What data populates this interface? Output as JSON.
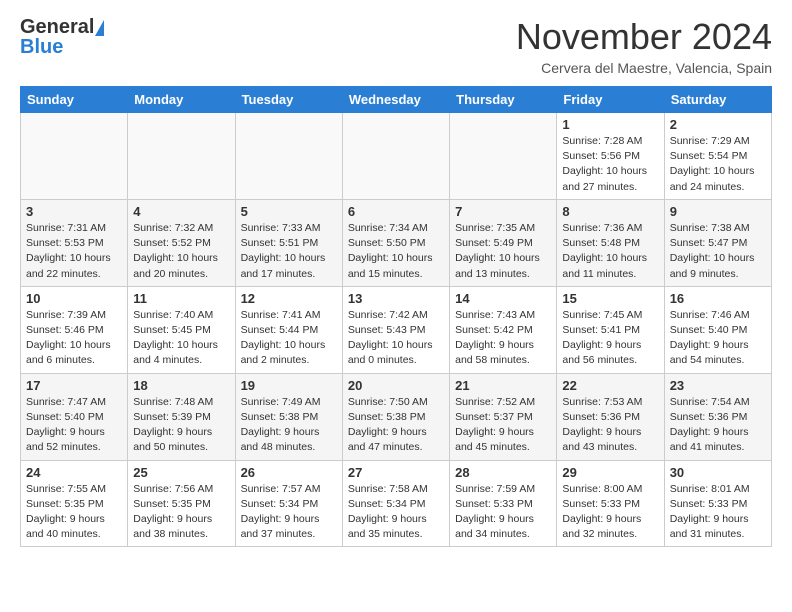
{
  "header": {
    "logo_general": "General",
    "logo_blue": "Blue",
    "month_title": "November 2024",
    "location": "Cervera del Maestre, Valencia, Spain"
  },
  "weekdays": [
    "Sunday",
    "Monday",
    "Tuesday",
    "Wednesday",
    "Thursday",
    "Friday",
    "Saturday"
  ],
  "weeks": [
    [
      {
        "day": "",
        "info": ""
      },
      {
        "day": "",
        "info": ""
      },
      {
        "day": "",
        "info": ""
      },
      {
        "day": "",
        "info": ""
      },
      {
        "day": "",
        "info": ""
      },
      {
        "day": "1",
        "info": "Sunrise: 7:28 AM\nSunset: 5:56 PM\nDaylight: 10 hours and 27 minutes."
      },
      {
        "day": "2",
        "info": "Sunrise: 7:29 AM\nSunset: 5:54 PM\nDaylight: 10 hours and 24 minutes."
      }
    ],
    [
      {
        "day": "3",
        "info": "Sunrise: 7:31 AM\nSunset: 5:53 PM\nDaylight: 10 hours and 22 minutes."
      },
      {
        "day": "4",
        "info": "Sunrise: 7:32 AM\nSunset: 5:52 PM\nDaylight: 10 hours and 20 minutes."
      },
      {
        "day": "5",
        "info": "Sunrise: 7:33 AM\nSunset: 5:51 PM\nDaylight: 10 hours and 17 minutes."
      },
      {
        "day": "6",
        "info": "Sunrise: 7:34 AM\nSunset: 5:50 PM\nDaylight: 10 hours and 15 minutes."
      },
      {
        "day": "7",
        "info": "Sunrise: 7:35 AM\nSunset: 5:49 PM\nDaylight: 10 hours and 13 minutes."
      },
      {
        "day": "8",
        "info": "Sunrise: 7:36 AM\nSunset: 5:48 PM\nDaylight: 10 hours and 11 minutes."
      },
      {
        "day": "9",
        "info": "Sunrise: 7:38 AM\nSunset: 5:47 PM\nDaylight: 10 hours and 9 minutes."
      }
    ],
    [
      {
        "day": "10",
        "info": "Sunrise: 7:39 AM\nSunset: 5:46 PM\nDaylight: 10 hours and 6 minutes."
      },
      {
        "day": "11",
        "info": "Sunrise: 7:40 AM\nSunset: 5:45 PM\nDaylight: 10 hours and 4 minutes."
      },
      {
        "day": "12",
        "info": "Sunrise: 7:41 AM\nSunset: 5:44 PM\nDaylight: 10 hours and 2 minutes."
      },
      {
        "day": "13",
        "info": "Sunrise: 7:42 AM\nSunset: 5:43 PM\nDaylight: 10 hours and 0 minutes."
      },
      {
        "day": "14",
        "info": "Sunrise: 7:43 AM\nSunset: 5:42 PM\nDaylight: 9 hours and 58 minutes."
      },
      {
        "day": "15",
        "info": "Sunrise: 7:45 AM\nSunset: 5:41 PM\nDaylight: 9 hours and 56 minutes."
      },
      {
        "day": "16",
        "info": "Sunrise: 7:46 AM\nSunset: 5:40 PM\nDaylight: 9 hours and 54 minutes."
      }
    ],
    [
      {
        "day": "17",
        "info": "Sunrise: 7:47 AM\nSunset: 5:40 PM\nDaylight: 9 hours and 52 minutes."
      },
      {
        "day": "18",
        "info": "Sunrise: 7:48 AM\nSunset: 5:39 PM\nDaylight: 9 hours and 50 minutes."
      },
      {
        "day": "19",
        "info": "Sunrise: 7:49 AM\nSunset: 5:38 PM\nDaylight: 9 hours and 48 minutes."
      },
      {
        "day": "20",
        "info": "Sunrise: 7:50 AM\nSunset: 5:38 PM\nDaylight: 9 hours and 47 minutes."
      },
      {
        "day": "21",
        "info": "Sunrise: 7:52 AM\nSunset: 5:37 PM\nDaylight: 9 hours and 45 minutes."
      },
      {
        "day": "22",
        "info": "Sunrise: 7:53 AM\nSunset: 5:36 PM\nDaylight: 9 hours and 43 minutes."
      },
      {
        "day": "23",
        "info": "Sunrise: 7:54 AM\nSunset: 5:36 PM\nDaylight: 9 hours and 41 minutes."
      }
    ],
    [
      {
        "day": "24",
        "info": "Sunrise: 7:55 AM\nSunset: 5:35 PM\nDaylight: 9 hours and 40 minutes."
      },
      {
        "day": "25",
        "info": "Sunrise: 7:56 AM\nSunset: 5:35 PM\nDaylight: 9 hours and 38 minutes."
      },
      {
        "day": "26",
        "info": "Sunrise: 7:57 AM\nSunset: 5:34 PM\nDaylight: 9 hours and 37 minutes."
      },
      {
        "day": "27",
        "info": "Sunrise: 7:58 AM\nSunset: 5:34 PM\nDaylight: 9 hours and 35 minutes."
      },
      {
        "day": "28",
        "info": "Sunrise: 7:59 AM\nSunset: 5:33 PM\nDaylight: 9 hours and 34 minutes."
      },
      {
        "day": "29",
        "info": "Sunrise: 8:00 AM\nSunset: 5:33 PM\nDaylight: 9 hours and 32 minutes."
      },
      {
        "day": "30",
        "info": "Sunrise: 8:01 AM\nSunset: 5:33 PM\nDaylight: 9 hours and 31 minutes."
      }
    ]
  ]
}
